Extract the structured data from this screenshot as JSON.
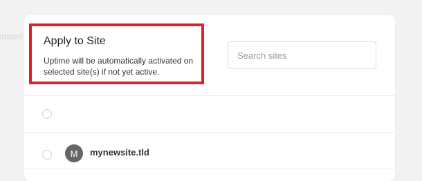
{
  "background": {
    "partial_text": "pdated"
  },
  "modal": {
    "title": "Apply to Site",
    "description": "Uptime will be automatically activated on selected site(s) if not yet active.",
    "search": {
      "placeholder": "Search sites",
      "value": ""
    },
    "highlight_color": "#e0202b",
    "sites": [
      {
        "name": "",
        "avatar_letter": "",
        "selected": false
      },
      {
        "name": "mynewsite.tld",
        "avatar_letter": "M",
        "selected": false
      }
    ]
  }
}
